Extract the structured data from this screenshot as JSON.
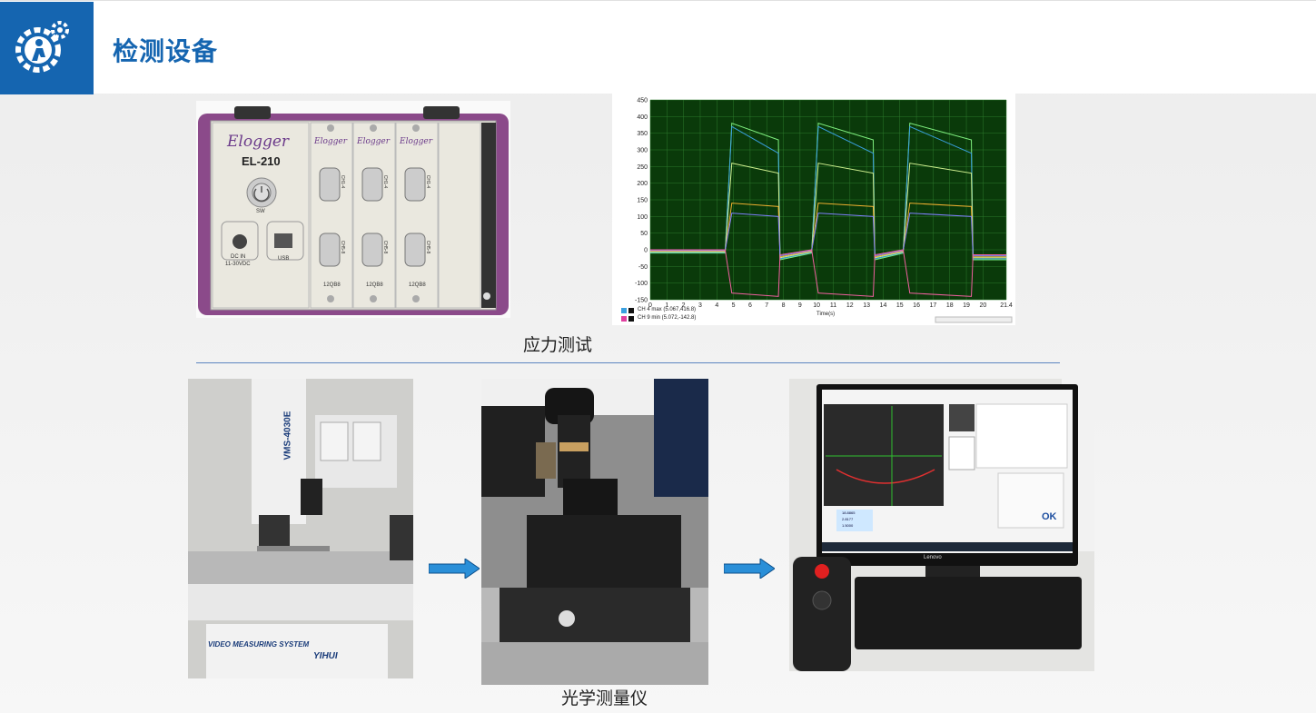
{
  "header": {
    "title": "检测设备",
    "logo_icon": "gear-worker-icon"
  },
  "stress_test": {
    "caption": "应力测试",
    "logger": {
      "brand": "Elogger",
      "model": "EL-210",
      "power_label": "SW",
      "dc_label_1": "DC IN",
      "dc_label_2": "11-30VDC",
      "usb_label": "USB",
      "module_label": "12QB8",
      "ch_top": "CH1-4",
      "ch_bottom": "CH5-8"
    },
    "chart": {
      "y_ticks": [
        "450",
        "400",
        "350",
        "300",
        "250",
        "200",
        "150",
        "100",
        "50",
        "0",
        "-50",
        "-100",
        "-150"
      ],
      "x_ticks": [
        "0",
        "1",
        "2",
        "3",
        "4",
        "5",
        "6",
        "7",
        "8",
        "9",
        "10",
        "11",
        "12",
        "13",
        "14",
        "15",
        "16",
        "17",
        "18",
        "19",
        "20",
        "21.4"
      ],
      "xlabel": "Time(s)",
      "legend_1": "CH 4 max (5.067,416.8)",
      "legend_2": "CH 9 min (5.072,-142.8)"
    }
  },
  "optical": {
    "caption": "光学测量仪",
    "vms": {
      "model": "VMS-4030E",
      "system": "VIDEO MEASURING SYSTEM",
      "brand": "YIHUI"
    },
    "monitor": {
      "brand": "Lenovo",
      "ok": "OK",
      "readout_x": "18.8865",
      "readout_y": "2.8177",
      "readout_z": "1.5000"
    }
  },
  "colors": {
    "accent": "#1565b0",
    "chart_bg": "#0a3a0a",
    "arrow": "#2a8fd8"
  }
}
